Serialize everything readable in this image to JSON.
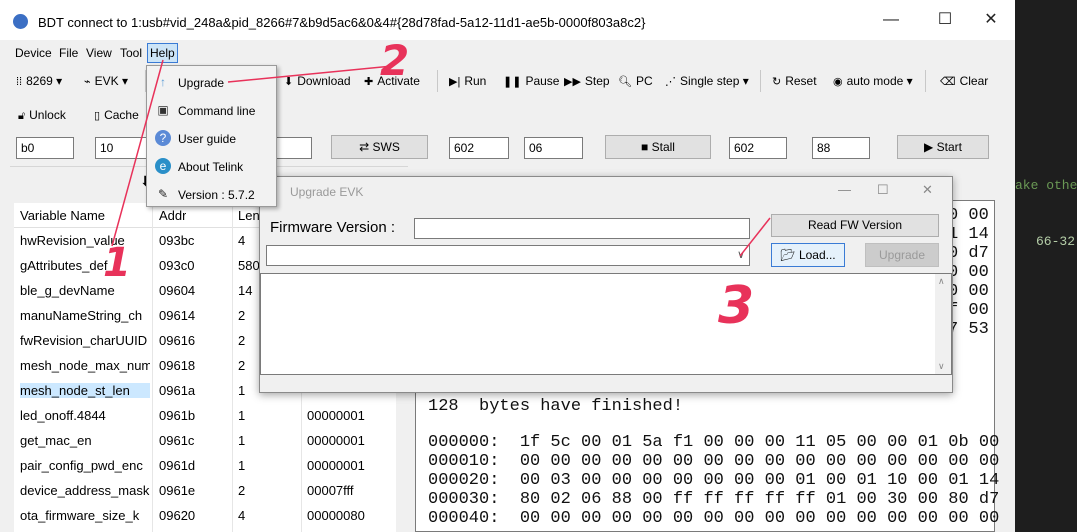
{
  "window": {
    "title": "BDT connect to 1:usb#vid_248a&pid_8266#7&b9d5ac6&0&4#{28d78fad-5a12-11d1-ae5b-0000f803a8c2}",
    "minimize": "—",
    "maximize": "☐",
    "close": "✕"
  },
  "menubar": [
    "Device",
    "File",
    "View",
    "Tool",
    "Help"
  ],
  "toolbar1": {
    "chip": "8269",
    "evk": "EVK",
    "download": "Download",
    "activate": "Activate",
    "run": "Run",
    "pause": "Pause",
    "step": "Step",
    "pc": "PC",
    "single_step": "Single step",
    "reset": "Reset",
    "auto_mode": "auto mode",
    "clear": "Clear"
  },
  "toolbar2": {
    "unlock": "Unlock",
    "cache": "Cache"
  },
  "fields": {
    "f1": "b0",
    "f2": "10",
    "sws": "SWS",
    "f3": "602",
    "f4": "06",
    "stall": "Stall",
    "f5": "602",
    "f6": "88",
    "start": "Start"
  },
  "help_menu": [
    {
      "icon": "upgrade-icon",
      "label": "Upgrade"
    },
    {
      "icon": "command-line-icon",
      "label": "Command line"
    },
    {
      "icon": "user-guide-icon",
      "label": "User guide"
    },
    {
      "icon": "about-telink-icon",
      "label": "About Telink"
    },
    {
      "icon": "version-icon",
      "label": "Version : 5.7.2"
    }
  ],
  "dialog": {
    "title": "Upgrade EVK",
    "firmware_label": "Firmware Version :",
    "firmware_value": "",
    "read_fw": "Read FW Version",
    "load": "Load...",
    "upgrade": "Upgrade"
  },
  "var_table": {
    "headers": [
      "Variable Name",
      "Addr",
      "Len"
    ],
    "rows": [
      {
        "name": "hwRevision_value",
        "addr": "093bc",
        "len": "4",
        "value": ""
      },
      {
        "name": "gAttributes_def",
        "addr": "093c0",
        "len": "580",
        "value": ""
      },
      {
        "name": "ble_g_devName",
        "addr": "09604",
        "len": "14",
        "value": ""
      },
      {
        "name": "manuNameString_ch",
        "addr": "09614",
        "len": "2",
        "value": ""
      },
      {
        "name": "fwRevision_charUUID",
        "addr": "09616",
        "len": "2",
        "value": ""
      },
      {
        "name": "mesh_node_max_num",
        "addr": "09618",
        "len": "2",
        "value": ""
      },
      {
        "name": "mesh_node_st_len",
        "addr": "0961a",
        "len": "1",
        "value": ""
      },
      {
        "name": "led_onoff.4844",
        "addr": "0961b",
        "len": "1",
        "value": "00000001"
      },
      {
        "name": "get_mac_en",
        "addr": "0961c",
        "len": "1",
        "value": "00000001"
      },
      {
        "name": "pair_config_pwd_enc",
        "addr": "0961d",
        "len": "1",
        "value": "00000001"
      },
      {
        "name": "device_address_mask",
        "addr": "0961e",
        "len": "2",
        "value": "00007fff"
      },
      {
        "name": "ota_firmware_size_k",
        "addr": "09620",
        "len": "4",
        "value": "00000080"
      }
    ]
  },
  "log": {
    "top_right": [
      "0 00",
      "1 14",
      "0 d7",
      "0 00",
      "0 00",
      "f 00",
      "7 53"
    ],
    "finished": "128  bytes have finished!",
    "lines": [
      "000000:  1f 5c 00 01 5a f1 00 00 00 11 05 00 00 01 0b 00",
      "000010:  00 00 00 00 00 00 00 00 00 00 00 00 00 00 00 00",
      "000020:  00 03 00 00 00 00 00 00 00 01 00 01 10 00 01 14",
      "000030:  80 02 06 88 00 ff ff ff ff ff 01 00 30 00 80 d7",
      "000040:  00 00 00 00 00 00 00 00 00 00 00 00 00 00 00 00"
    ]
  },
  "right_strip": [
    "ake other",
    "66-32"
  ],
  "annotations": [
    "1",
    "2",
    "3"
  ],
  "colors": {
    "annotation": "#e8325a",
    "menu_highlight": "#cce4f7",
    "selected_row": "#cce8ff"
  }
}
